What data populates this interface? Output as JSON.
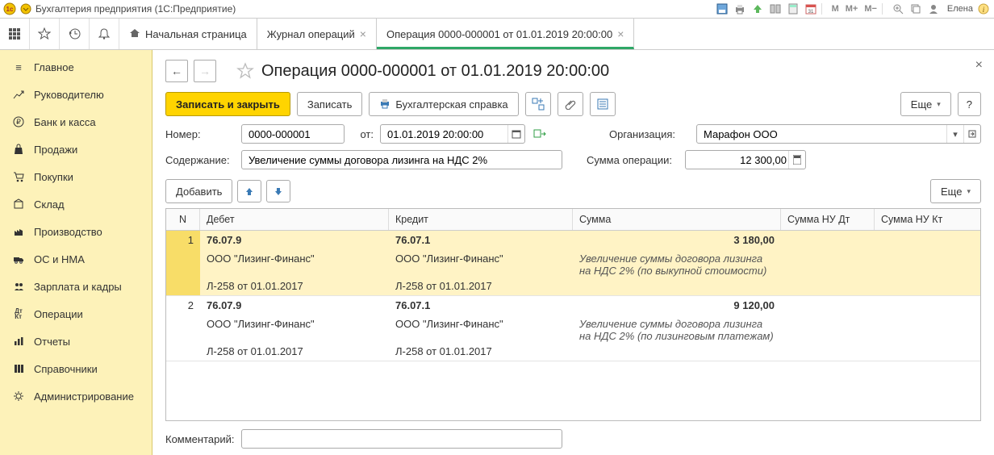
{
  "titlebar": {
    "title": "Бухгалтерия предприятия  (1С:Предприятие)",
    "user": "Елена",
    "m": "M",
    "mplus": "M+",
    "mminus": "M−"
  },
  "tabs": {
    "home": "Начальная страница",
    "journal": "Журнал операций",
    "current": "Операция 0000-000001 от 01.01.2019 20:00:00"
  },
  "sidebar": {
    "items": [
      {
        "icon": "menu",
        "label": "Главное"
      },
      {
        "icon": "chart",
        "label": "Руководителю"
      },
      {
        "icon": "bank",
        "label": "Банк и касса"
      },
      {
        "icon": "bag",
        "label": "Продажи"
      },
      {
        "icon": "cart",
        "label": "Покупки"
      },
      {
        "icon": "box",
        "label": "Склад"
      },
      {
        "icon": "factory",
        "label": "Производство"
      },
      {
        "icon": "truck",
        "label": "ОС и НМА"
      },
      {
        "icon": "people",
        "label": "Зарплата и кадры"
      },
      {
        "icon": "dtkt",
        "label": "Операции"
      },
      {
        "icon": "bars",
        "label": "Отчеты"
      },
      {
        "icon": "books",
        "label": "Справочники"
      },
      {
        "icon": "gear",
        "label": "Администрирование"
      }
    ]
  },
  "page": {
    "title": "Операция 0000-000001 от 01.01.2019 20:00:00",
    "buttons": {
      "save_close": "Записать и закрыть",
      "save": "Записать",
      "print": "Бухгалтерская справка",
      "more": "Еще",
      "help": "?"
    },
    "fields": {
      "number_label": "Номер:",
      "number_value": "0000-000001",
      "from_label": "от:",
      "date_value": "01.01.2019 20:00:00",
      "org_label": "Организация:",
      "org_value": "Марафон ООО",
      "content_label": "Содержание:",
      "content_value": "Увеличение суммы договора лизинга на НДС 2%",
      "sum_label": "Сумма операции:",
      "sum_value": "12 300,00",
      "comment_label": "Комментарий:",
      "comment_value": ""
    },
    "list": {
      "add": "Добавить",
      "more": "Еще",
      "columns": {
        "n": "N",
        "debit": "Дебет",
        "credit": "Кредит",
        "sum": "Сумма",
        "sum_nu_dt": "Сумма НУ Дт",
        "sum_nu_kt": "Сумма НУ Кт"
      },
      "rows": [
        {
          "n": "1",
          "d_acc": "76.07.9",
          "k_acc": "76.07.1",
          "sum": "3 180,00",
          "d_sub1": "ООО \"Лизинг-Финанс\"",
          "k_sub1": "ООО \"Лизинг-Финанс\"",
          "d_sub2": "Л-258 от 01.01.2017",
          "k_sub2": "Л-258 от 01.01.2017",
          "note": "Увеличение суммы договора лизинга на НДС 2% (по выкупной стоимости)"
        },
        {
          "n": "2",
          "d_acc": "76.07.9",
          "k_acc": "76.07.1",
          "sum": "9 120,00",
          "d_sub1": "ООО \"Лизинг-Финанс\"",
          "k_sub1": "ООО \"Лизинг-Финанс\"",
          "d_sub2": "Л-258 от 01.01.2017",
          "k_sub2": "Л-258 от 01.01.2017",
          "note": "Увеличение суммы договора лизинга на НДС 2% (по лизинговым платежам)"
        }
      ]
    }
  }
}
